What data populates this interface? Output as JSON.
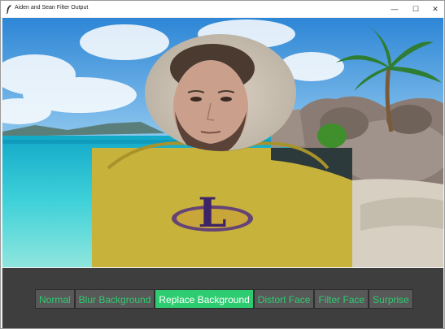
{
  "window": {
    "title": "Aiden and Sean Filter Output",
    "minimize_glyph": "—",
    "maximize_glyph": "☐",
    "close_glyph": "✕"
  },
  "theme": {
    "accent": "#2ecc71",
    "button_bg": "#585858",
    "panel_bg": "#3e3e3e"
  },
  "filters": {
    "selected": "Replace Background",
    "buttons": [
      {
        "label": "Normal"
      },
      {
        "label": "Blur Background"
      },
      {
        "label": "Replace Background"
      },
      {
        "label": "Distort Face"
      },
      {
        "label": "Filter Face"
      },
      {
        "label": "Surprise"
      }
    ]
  },
  "video": {
    "background_scene": "beach-with-palm-tree",
    "shirt_logo_letter": "L"
  }
}
